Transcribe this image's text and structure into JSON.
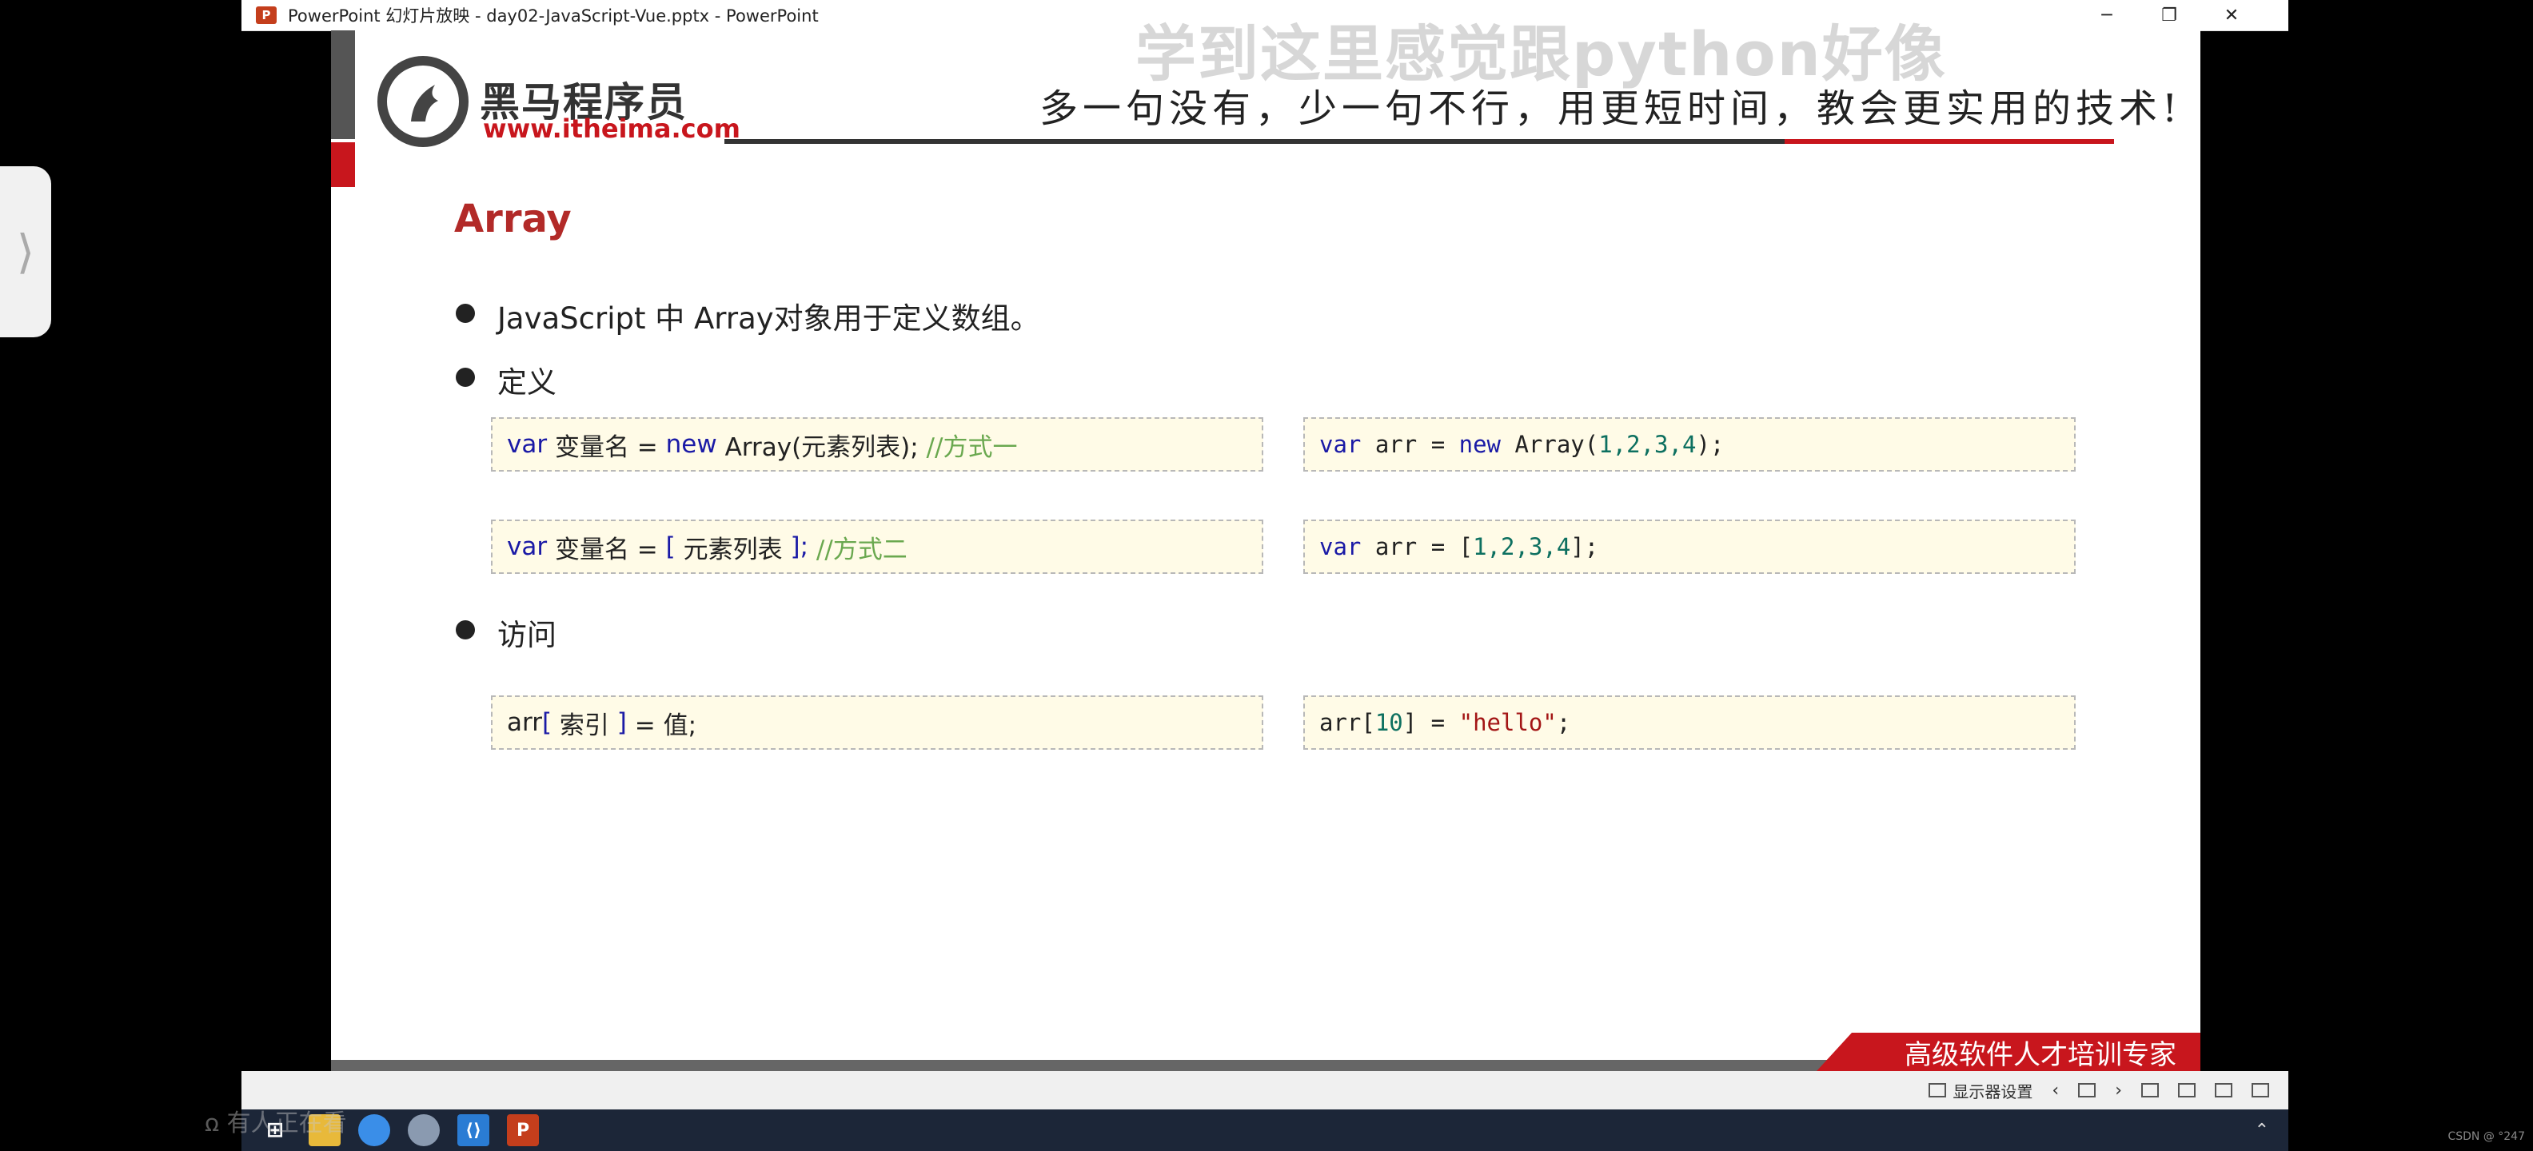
{
  "window": {
    "title": "PowerPoint 幻灯片放映  -  day02-JavaScript-Vue.pptx - PowerPoint",
    "minimize": "─",
    "restore": "❐",
    "close": "✕"
  },
  "overlay": {
    "top_text": "学到这里感觉跟python好像",
    "bottom_text": "ꭥ  有人正在看"
  },
  "slide": {
    "logo_name": "黑马程序员",
    "logo_url": "www.itheima.com",
    "slogan": "多一句没有，少一句不行，用更短时间，教会更实用的技术!",
    "title": "Array",
    "bullets": [
      "JavaScript 中 Array对象用于定义数组。",
      "定义",
      "访问"
    ],
    "code": {
      "def1": {
        "kw": "var",
        "name": " 变量名 = ",
        "kw2": "new",
        "rest": " Array(元素列表);",
        "comment": " //方式一"
      },
      "ex1": {
        "kw": "var",
        "mid": " arr = ",
        "kw2": "new",
        "call": " Array(",
        "nums": "1,2,3,4",
        "end": ");"
      },
      "def2": {
        "kw": "var",
        "name": " 变量名 = ",
        "open": "[",
        "mid": " 元素列表 ",
        "close": "];",
        "comment": " //方式二"
      },
      "ex2": {
        "kw": "var",
        "mid": " arr = [",
        "nums": "1,2,3,4",
        "end": "];"
      },
      "acc1": {
        "pre": "arr",
        "open": "[",
        "mid": " 索引 ",
        "close": "]",
        "eq": " = 值;"
      },
      "acc2": {
        "pre": "arr[",
        "num": "10",
        "mid": "] = ",
        "str": "\"hello\"",
        "end": ";"
      }
    },
    "footer_text": "高级软件人才培训专家"
  },
  "statusbar": {
    "display_settings": "显示器设置"
  },
  "corner": "CSDN @ °247"
}
